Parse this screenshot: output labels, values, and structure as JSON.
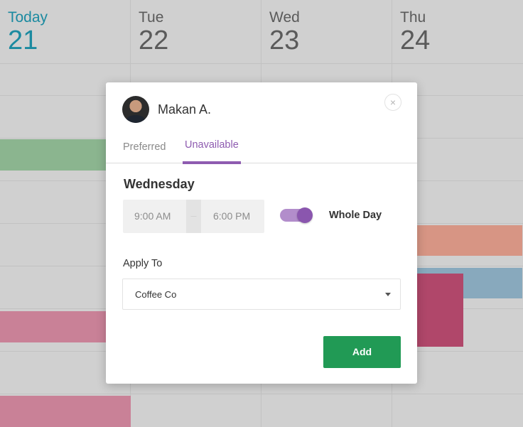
{
  "calendar": {
    "days": [
      {
        "name": "Today",
        "number": "21"
      },
      {
        "name": "Tue",
        "number": "22"
      },
      {
        "name": "Wed",
        "number": "23"
      },
      {
        "name": "Thu",
        "number": "24"
      }
    ],
    "event_colors": {
      "green": "#8bb58f",
      "pink": "#c98197",
      "salmon": "#d79584",
      "blue": "#88a9bd",
      "magenta": "#b0476a"
    },
    "today_color": "#1b8aa0"
  },
  "dialog": {
    "user": {
      "name": "Makan A.",
      "avatar_icon": "user-avatar"
    },
    "close_icon": "×",
    "tabs": [
      {
        "label": "Preferred",
        "active": false
      },
      {
        "label": "Unavailable",
        "active": true
      }
    ],
    "accent_color": "#8e5bb0",
    "day_title": "Wednesday",
    "time_start": "9:00 AM",
    "time_separator": "–",
    "time_end": "6:00 PM",
    "whole_day": {
      "label": "Whole Day",
      "enabled": true
    },
    "apply_to": {
      "label": "Apply To",
      "value": "Coffee Co"
    },
    "add_button": {
      "label": "Add",
      "color": "#219a55"
    }
  }
}
